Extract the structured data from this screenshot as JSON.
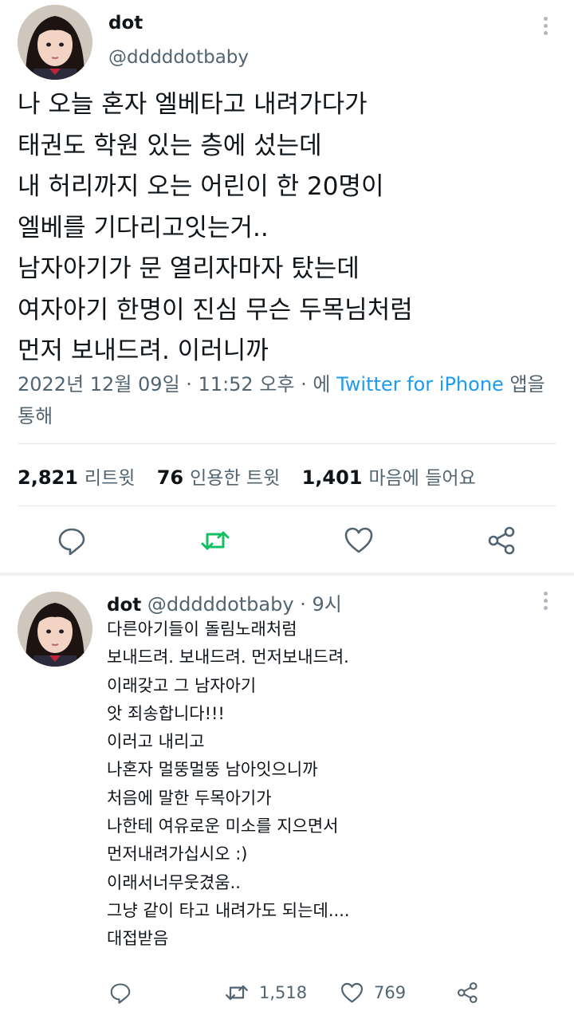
{
  "main_tweet": {
    "author_name": "dot",
    "author_handle": "@dddddotbaby",
    "lines": [
      "나 오늘 혼자 엘베타고 내려가다가",
      "태권도 학원 있는 층에 섰는데",
      "내 허리까지 오는 어린이 한 20명이",
      "엘베를 기다리고잇는거..",
      "남자아기가 문 열리자마자 탔는데",
      "여자아기 한명이 진심 무슨 두목님처럼",
      "먼저 보내드려. 이러니까"
    ],
    "timestamp": "2022년 12월 09일 · 11:52 오후 · 에 ",
    "source_app": "Twitter for iPhone",
    "source_suffix": " 앱을 통해",
    "stats": {
      "retweets_count": "2,821",
      "retweets_label": "리트윗",
      "quotes_count": "76",
      "quotes_label": "인용한 트윗",
      "likes_count": "1,401",
      "likes_label": "마음에 들어요"
    }
  },
  "reply_tweet": {
    "author_name": "dot",
    "author_handle": "@dddddotbaby",
    "time": "· 9시",
    "lines": [
      "다른아기들이 돌림노래처럼",
      "보내드려. 보내드려. 먼저보내드려.",
      "이래갖고 그 남자아기",
      "앗 죄송합니다!!!",
      "이러고 내리고",
      "나혼자 멀뚱멀뚱 남아잇으니까",
      "처음에 말한 두목아기가",
      "나한테 여유로운 미소를 지으면서",
      "먼저내려가십시오 :)",
      "이래서너무웃겼움..",
      "그냥 같이 타고 내려가도 되는데....",
      "대접받음"
    ],
    "retweet_count": "1,518",
    "like_count": "769"
  },
  "icons": {
    "reply": "reply-icon",
    "retweet": "retweet-icon",
    "like": "heart-icon",
    "share": "share-icon",
    "more": "more-options-icon"
  },
  "colors": {
    "retweet_green": "#17bf63",
    "link_blue": "#1d9bf0",
    "secondary_text": "#536471",
    "icon_gray": "#536471"
  }
}
